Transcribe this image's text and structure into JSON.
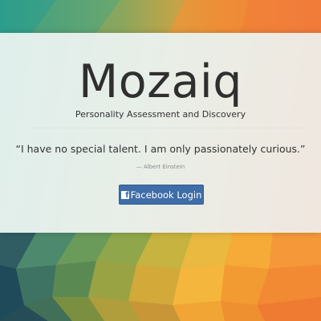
{
  "app": {
    "title": "Mozaiq",
    "subtitle": "Personality Assessment and Discovery"
  },
  "quote": {
    "text": "“I have no special talent. I am only passionately curious.”",
    "cite": "— Albert Einstein"
  },
  "login": {
    "icon": "facebook-icon",
    "icon_glyph": "f",
    "label": "Facebook Login"
  },
  "colors": {
    "button": "#3f6da8",
    "title": "#2f2f2f"
  }
}
